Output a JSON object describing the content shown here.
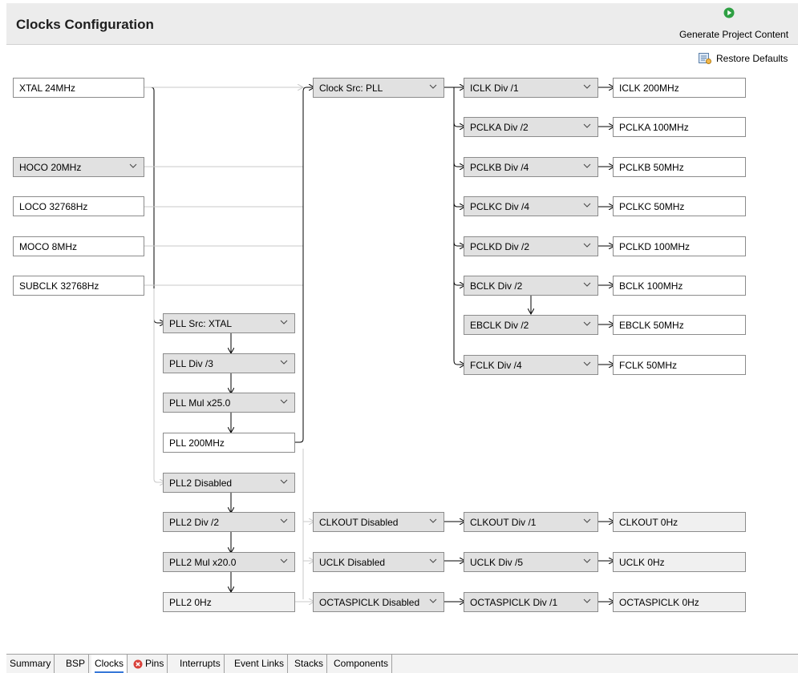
{
  "header": {
    "title": "Clocks Configuration",
    "generate_label": "Generate Project Content",
    "restore_label": "Restore Defaults"
  },
  "sources": {
    "xtal": "XTAL 24MHz",
    "hoco": "HOCO 20MHz",
    "loco": "LOCO 32768Hz",
    "moco": "MOCO 8MHz",
    "subclk": "SUBCLK 32768Hz"
  },
  "pll": {
    "src": "PLL Src: XTAL",
    "div": "PLL Div /3",
    "mul": "PLL Mul x25.0",
    "out": "PLL 200MHz"
  },
  "pll2": {
    "src": "PLL2 Disabled",
    "div": "PLL2 Div /2",
    "mul": "PLL2 Mul x20.0",
    "out": "PLL2 0Hz"
  },
  "clock_src": "Clock Src: PLL",
  "dividers": {
    "iclk": "ICLK Div /1",
    "pclka": "PCLKA Div /2",
    "pclkb": "PCLKB Div /4",
    "pclkc": "PCLKC Div /4",
    "pclkd": "PCLKD Div /2",
    "bclk": "BCLK Div /2",
    "ebclk": "EBCLK Div /2",
    "fclk": "FCLK Div /4"
  },
  "outputs": {
    "iclk": "ICLK 200MHz",
    "pclka": "PCLKA 100MHz",
    "pclkb": "PCLKB 50MHz",
    "pclkc": "PCLKC 50MHz",
    "pclkd": "PCLKD 100MHz",
    "bclk": "BCLK 100MHz",
    "ebclk": "EBCLK 50MHz",
    "fclk": "FCLK 50MHz"
  },
  "aux": {
    "clkout_src": "CLKOUT Disabled",
    "clkout_div": "CLKOUT Div /1",
    "clkout_out": "CLKOUT 0Hz",
    "uclk_src": "UCLK Disabled",
    "uclk_div": "UCLK Div /5",
    "uclk_out": "UCLK 0Hz",
    "octa_src": "OCTASPICLK Disabled",
    "octa_div": "OCTASPICLK Div /1",
    "octa_out": "OCTASPICLK 0Hz"
  },
  "tabs": [
    "Summary",
    "BSP",
    "Clocks",
    "Pins",
    "Interrupts",
    "Event Links",
    "Stacks",
    "Components"
  ],
  "active_tab": "Clocks",
  "colors": {
    "active_line": "#000000",
    "inactive_line": "#c8c8c8",
    "select_bg": "#e1e1e1",
    "generate_icon": "#2ea043",
    "error_icon": "#d9413a",
    "tab_underline": "#3778d8"
  }
}
